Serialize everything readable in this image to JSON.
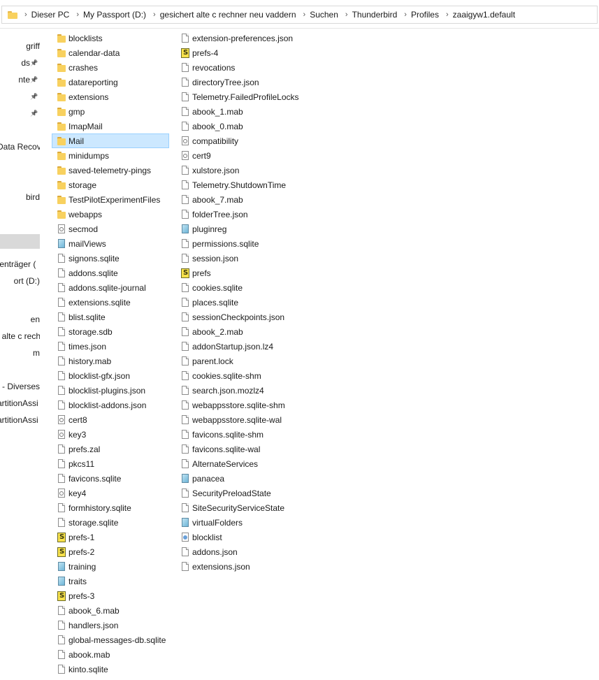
{
  "address_bar": {
    "crumbs": [
      "Dieser PC",
      "My Passport (D:)",
      "gesichert alte c rechner neu vaddern",
      "Suchen",
      "Thunderbird",
      "Profiles",
      "zaaigyw1.default"
    ]
  },
  "nav_pane": {
    "items": [
      {
        "label": "griff",
        "pinned": false
      },
      {
        "label": "ds",
        "pinned": true
      },
      {
        "label": "nte",
        "pinned": true
      },
      {
        "label": "",
        "pinned": true
      },
      {
        "label": "",
        "pinned": true
      },
      {
        "label": "Data Recove",
        "pinned": false
      },
      {
        "label": "bird",
        "pinned": false
      },
      {
        "label": "",
        "pinned": false
      },
      {
        "label": "tenträger (",
        "pinned": false
      },
      {
        "label": "ort (D:)",
        "pinned": false
      },
      {
        "label": "en",
        "pinned": false
      },
      {
        "label": "t alte c rech",
        "pinned": false
      },
      {
        "label": "m",
        "pinned": false
      },
      {
        "label": "- Diverses",
        "pinned": false
      },
      {
        "label": "artitionAssi",
        "pinned": false
      },
      {
        "label": "artitionAssi",
        "pinned": false
      }
    ]
  },
  "files": {
    "column1": [
      {
        "name": "blocklists",
        "icon": "folder-icon"
      },
      {
        "name": "calendar-data",
        "icon": "folder-icon"
      },
      {
        "name": "crashes",
        "icon": "folder-icon"
      },
      {
        "name": "datareporting",
        "icon": "folder-icon"
      },
      {
        "name": "extensions",
        "icon": "folder-icon"
      },
      {
        "name": "gmp",
        "icon": "folder-icon"
      },
      {
        "name": "ImapMail",
        "icon": "folder-icon"
      },
      {
        "name": "Mail",
        "icon": "folder-icon",
        "selected": true
      },
      {
        "name": "minidumps",
        "icon": "folder-icon"
      },
      {
        "name": "saved-telemetry-pings",
        "icon": "folder-icon"
      },
      {
        "name": "storage",
        "icon": "folder-icon"
      },
      {
        "name": "TestPilotExperimentFiles",
        "icon": "folder-icon"
      },
      {
        "name": "webapps",
        "icon": "folder-icon"
      },
      {
        "name": "secmod",
        "icon": "cert-icon"
      },
      {
        "name": "mailViews",
        "icon": "data-file-icon"
      },
      {
        "name": "signons.sqlite",
        "icon": "file-icon"
      },
      {
        "name": "addons.sqlite",
        "icon": "file-icon"
      },
      {
        "name": "addons.sqlite-journal",
        "icon": "file-icon"
      },
      {
        "name": "extensions.sqlite",
        "icon": "file-icon"
      },
      {
        "name": "blist.sqlite",
        "icon": "file-icon"
      },
      {
        "name": "storage.sdb",
        "icon": "file-icon"
      },
      {
        "name": "times.json",
        "icon": "file-icon"
      },
      {
        "name": "history.mab",
        "icon": "file-icon"
      },
      {
        "name": "blocklist-gfx.json",
        "icon": "file-icon"
      },
      {
        "name": "blocklist-plugins.json",
        "icon": "file-icon"
      },
      {
        "name": "blocklist-addons.json",
        "icon": "file-icon"
      },
      {
        "name": "cert8",
        "icon": "cert-icon"
      },
      {
        "name": "key3",
        "icon": "cert-icon"
      },
      {
        "name": "prefs.zal",
        "icon": "file-icon"
      },
      {
        "name": "pkcs11",
        "icon": "file-icon"
      },
      {
        "name": "favicons.sqlite",
        "icon": "file-icon"
      },
      {
        "name": "key4",
        "icon": "cert-icon"
      },
      {
        "name": "formhistory.sqlite",
        "icon": "file-icon"
      },
      {
        "name": "storage.sqlite",
        "icon": "file-icon"
      },
      {
        "name": "prefs-1",
        "icon": "prefs-script-icon"
      },
      {
        "name": "prefs-2",
        "icon": "prefs-script-icon"
      },
      {
        "name": "training",
        "icon": "data-file-icon"
      },
      {
        "name": "traits",
        "icon": "data-file-icon"
      },
      {
        "name": "prefs-3",
        "icon": "prefs-script-icon"
      },
      {
        "name": "abook_6.mab",
        "icon": "file-icon"
      },
      {
        "name": "handlers.json",
        "icon": "file-icon"
      },
      {
        "name": "global-messages-db.sqlite",
        "icon": "file-icon"
      },
      {
        "name": "abook.mab",
        "icon": "file-icon"
      },
      {
        "name": "kinto.sqlite",
        "icon": "file-icon"
      }
    ],
    "column2": [
      {
        "name": "extension-preferences.json",
        "icon": "file-icon"
      },
      {
        "name": "prefs-4",
        "icon": "prefs-script-icon"
      },
      {
        "name": "revocations",
        "icon": "file-icon"
      },
      {
        "name": "directoryTree.json",
        "icon": "file-icon"
      },
      {
        "name": "Telemetry.FailedProfileLocks",
        "icon": "file-icon"
      },
      {
        "name": "abook_1.mab",
        "icon": "file-icon"
      },
      {
        "name": "abook_0.mab",
        "icon": "file-icon"
      },
      {
        "name": "compatibility",
        "icon": "cert-icon"
      },
      {
        "name": "cert9",
        "icon": "cert-icon"
      },
      {
        "name": "xulstore.json",
        "icon": "file-icon"
      },
      {
        "name": "Telemetry.ShutdownTime",
        "icon": "file-icon"
      },
      {
        "name": "abook_7.mab",
        "icon": "file-icon"
      },
      {
        "name": "folderTree.json",
        "icon": "file-icon"
      },
      {
        "name": "pluginreg",
        "icon": "data-file-icon"
      },
      {
        "name": "permissions.sqlite",
        "icon": "file-icon"
      },
      {
        "name": "session.json",
        "icon": "file-icon"
      },
      {
        "name": "prefs",
        "icon": "prefs-script-icon"
      },
      {
        "name": "cookies.sqlite",
        "icon": "file-icon"
      },
      {
        "name": "places.sqlite",
        "icon": "file-icon"
      },
      {
        "name": "sessionCheckpoints.json",
        "icon": "file-icon"
      },
      {
        "name": "abook_2.mab",
        "icon": "file-icon"
      },
      {
        "name": "addonStartup.json.lz4",
        "icon": "file-icon"
      },
      {
        "name": "parent.lock",
        "icon": "file-icon"
      },
      {
        "name": "cookies.sqlite-shm",
        "icon": "file-icon"
      },
      {
        "name": "search.json.mozlz4",
        "icon": "file-icon"
      },
      {
        "name": "webappsstore.sqlite-shm",
        "icon": "file-icon"
      },
      {
        "name": "webappsstore.sqlite-wal",
        "icon": "file-icon"
      },
      {
        "name": "favicons.sqlite-shm",
        "icon": "file-icon"
      },
      {
        "name": "favicons.sqlite-wal",
        "icon": "file-icon"
      },
      {
        "name": "AlternateServices",
        "icon": "file-icon"
      },
      {
        "name": "panacea",
        "icon": "data-file-icon"
      },
      {
        "name": "SecurityPreloadState",
        "icon": "file-icon"
      },
      {
        "name": "SiteSecurityServiceState",
        "icon": "file-icon"
      },
      {
        "name": "virtualFolders",
        "icon": "data-file-icon"
      },
      {
        "name": "blocklist",
        "icon": "xml-file-icon"
      },
      {
        "name": "addons.json",
        "icon": "file-icon"
      },
      {
        "name": "extensions.json",
        "icon": "file-icon"
      }
    ]
  }
}
